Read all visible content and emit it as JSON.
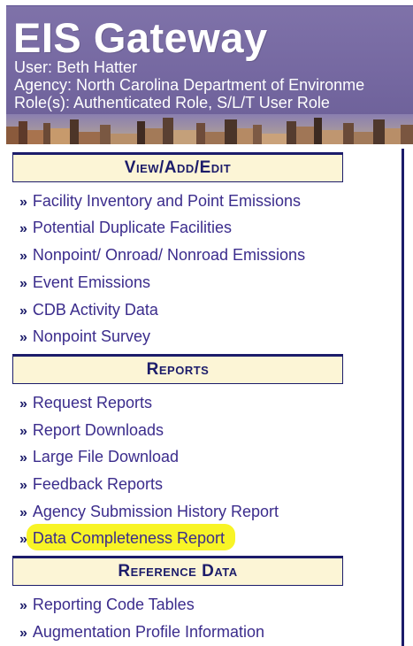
{
  "header": {
    "title": "EIS Gateway",
    "user": "User: Beth Hatter",
    "agency": "Agency: North Carolina Department of Environme",
    "roles": "Role(s): Authenticated Role, S/L/T User Role"
  },
  "colors": {
    "banner": "#7467a0",
    "section_bg": "#fcf5d6",
    "navy": "#1c1c6a",
    "link": "#3b2c8c",
    "highlight": "#f7f200"
  },
  "nav_arrow": "»",
  "sections": {
    "view_add_edit": {
      "title": "View/Add/Edit",
      "items": [
        "Facility Inventory and Point Emissions",
        "Potential Duplicate Facilities",
        "Nonpoint/ Onroad/ Nonroad Emissions",
        "Event Emissions",
        "CDB Activity Data",
        "Nonpoint Survey"
      ]
    },
    "reports": {
      "title": "Reports",
      "items": [
        "Request Reports",
        "Report Downloads",
        "Large File Download",
        "Feedback Reports",
        "Agency Submission History Report",
        "Data Completeness Report"
      ]
    },
    "reference_data": {
      "title": "Reference Data",
      "items": [
        "Reporting Code Tables",
        "Augmentation Profile Information"
      ]
    }
  }
}
